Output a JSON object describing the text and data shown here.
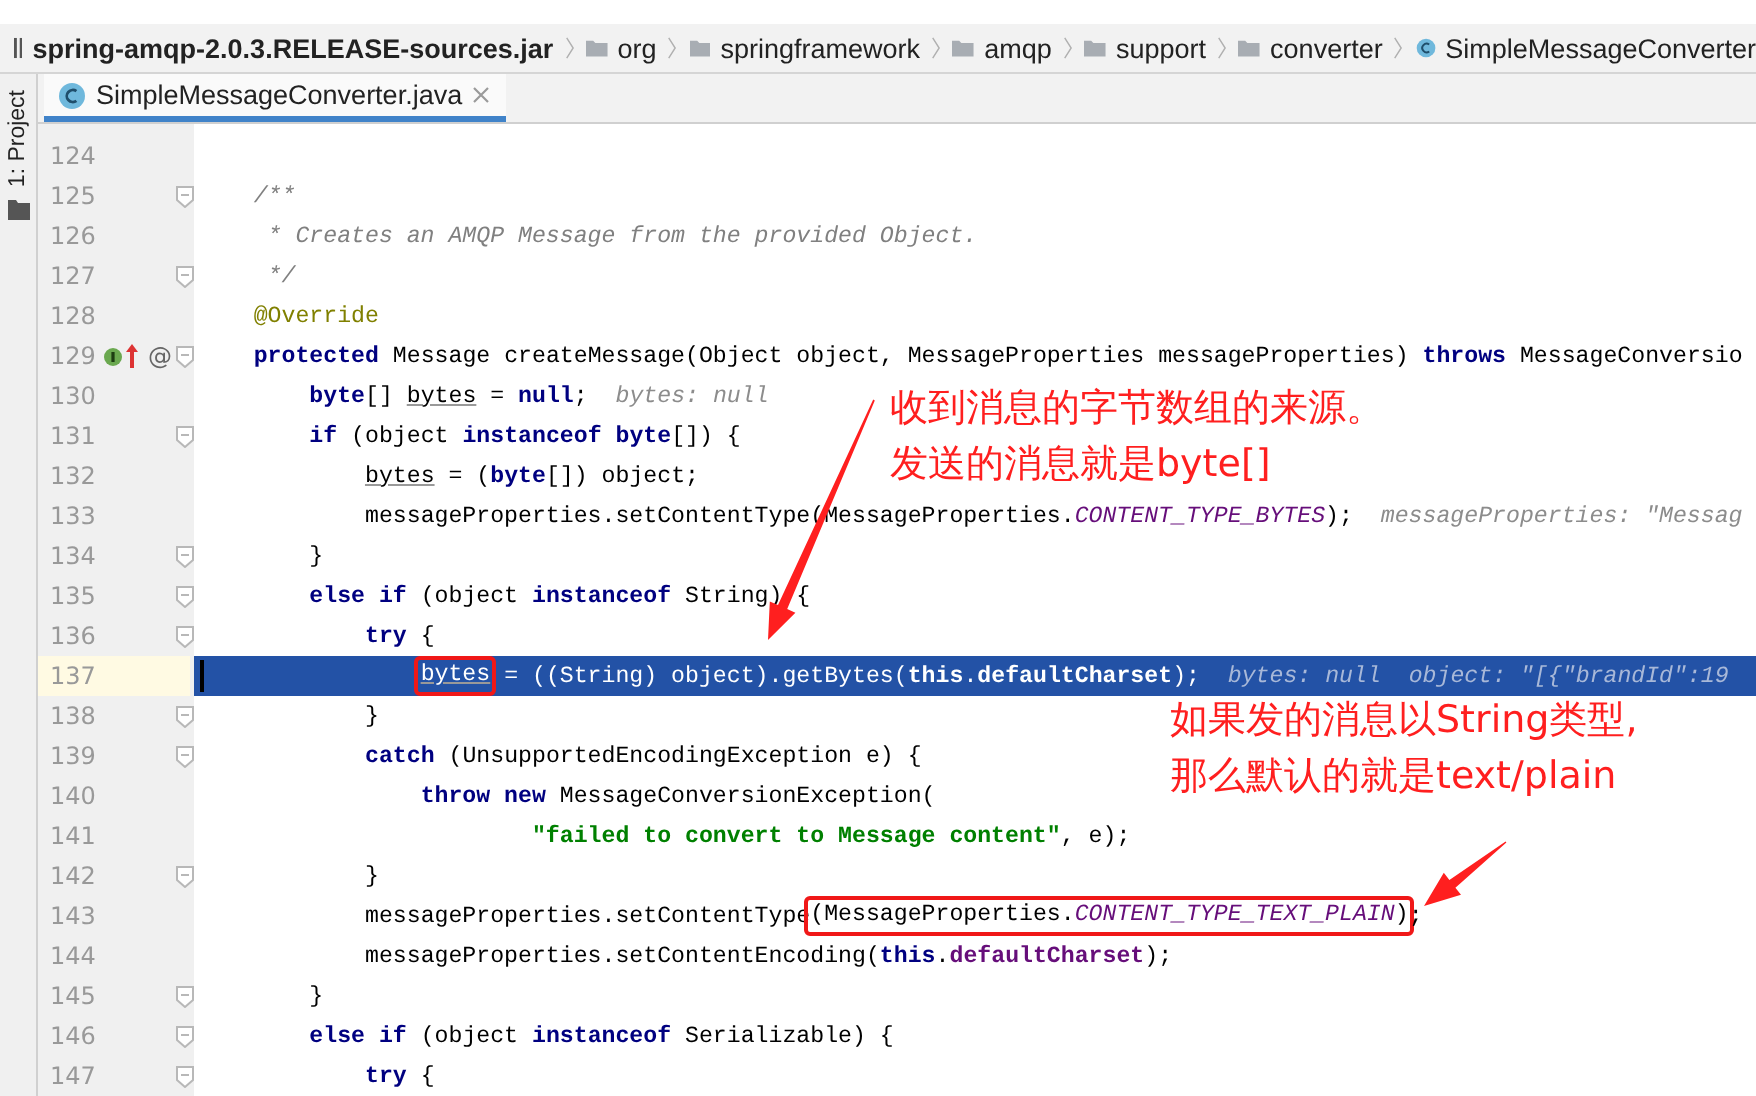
{
  "breadcrumb": {
    "root": "spring-amqp-2.0.3.RELEASE-sources.jar",
    "items": [
      {
        "kind": "folder",
        "label": "org"
      },
      {
        "kind": "folder",
        "label": "springframework"
      },
      {
        "kind": "folder",
        "label": "amqp"
      },
      {
        "kind": "folder",
        "label": "support"
      },
      {
        "kind": "folder",
        "label": "converter"
      },
      {
        "kind": "class",
        "label": "SimpleMessageConverter"
      }
    ]
  },
  "tool_window_tab": "1: Project",
  "tabs": [
    {
      "label": "SimpleMessageConverter.java",
      "selected": true
    }
  ],
  "lines": [
    {
      "number": "124",
      "fold": false,
      "selected": false
    },
    {
      "number": "125",
      "fold": true,
      "selected": false,
      "tokens": [
        {
          "kind": "comment",
          "text": "    /**"
        }
      ]
    },
    {
      "number": "126",
      "fold": false,
      "selected": false,
      "tokens": [
        {
          "kind": "comment",
          "text": "     * Creates an AMQP Message from the provided Object."
        }
      ]
    },
    {
      "number": "127",
      "fold": true,
      "selected": false,
      "tokens": [
        {
          "kind": "comment",
          "text": "     */"
        }
      ]
    },
    {
      "number": "128",
      "fold": false,
      "selected": false,
      "tokens": [
        {
          "kind": "annotation",
          "text": "    @Override"
        }
      ]
    },
    {
      "number": "129",
      "fold": true,
      "selected": false,
      "gutter_mark": "@",
      "tokens": [
        {
          "kind": "keyword",
          "text": "    protected"
        },
        {
          "kind": "plain",
          "text": " Message createMessage(Object object, MessageProperties messageProperties) "
        },
        {
          "kind": "keyword",
          "text": "throws"
        },
        {
          "kind": "plain",
          "text": " MessageConversio"
        }
      ]
    },
    {
      "number": "130",
      "fold": false,
      "selected": false,
      "hints": [
        "bytes: null"
      ],
      "tokens": [
        {
          "kind": "keyword",
          "text": "        byte"
        },
        {
          "kind": "plain",
          "text": "[] "
        },
        {
          "kind": "variable",
          "text": "bytes"
        },
        {
          "kind": "plain",
          "text": " = "
        },
        {
          "kind": "keyword",
          "text": "null"
        },
        {
          "kind": "plain",
          "text": ";"
        }
      ]
    },
    {
      "number": "131",
      "fold": true,
      "selected": false,
      "tokens": [
        {
          "kind": "keyword",
          "text": "        if"
        },
        {
          "kind": "plain",
          "text": " (object "
        },
        {
          "kind": "keyword",
          "text": "instanceof byte"
        },
        {
          "kind": "plain",
          "text": "[]) {"
        }
      ]
    },
    {
      "number": "132",
      "fold": false,
      "selected": false,
      "tokens": [
        {
          "kind": "variable",
          "text": "            bytes"
        },
        {
          "kind": "plain",
          "text": " = ("
        },
        {
          "kind": "keyword",
          "text": "byte"
        },
        {
          "kind": "plain",
          "text": "[]) object;"
        }
      ]
    },
    {
      "number": "133",
      "fold": false,
      "selected": false,
      "hints": [
        "messageProperties: \"Messag"
      ],
      "tokens": [
        {
          "kind": "plain",
          "text": "            messageProperties.setContentType(MessageProperties."
        },
        {
          "kind": "constant",
          "text": "CONTENT_TYPE_BYTES"
        },
        {
          "kind": "plain",
          "text": ");"
        }
      ]
    },
    {
      "number": "134",
      "fold": true,
      "selected": false,
      "tokens": [
        {
          "kind": "plain",
          "text": "        }"
        }
      ]
    },
    {
      "number": "135",
      "fold": true,
      "selected": false,
      "tokens": [
        {
          "kind": "keyword",
          "text": "        else if"
        },
        {
          "kind": "plain",
          "text": " (object "
        },
        {
          "kind": "keyword",
          "text": "instanceof"
        },
        {
          "kind": "plain",
          "text": " String) {"
        }
      ]
    },
    {
      "number": "136",
      "fold": true,
      "selected": false,
      "tokens": [
        {
          "kind": "keyword",
          "text": "            try"
        },
        {
          "kind": "plain",
          "text": " {"
        }
      ]
    },
    {
      "number": "137",
      "fold": false,
      "selected": true,
      "hints": [
        "bytes: null",
        "object: \"[{\"brandId\":19"
      ],
      "tokens": [
        {
          "kind": "boxed",
          "tokens": [
            {
              "kind": "variable",
              "text": "                bytes"
            }
          ]
        },
        {
          "kind": "plain",
          "text": " = ((String) object).getBytes("
        },
        {
          "kind": "keyword",
          "text": "this"
        },
        {
          "kind": "plain",
          "text": "."
        },
        {
          "kind": "field",
          "text": "defaultCharset"
        },
        {
          "kind": "plain",
          "text": ");"
        }
      ]
    },
    {
      "number": "138",
      "fold": true,
      "selected": false,
      "tokens": [
        {
          "kind": "plain",
          "text": "            }"
        }
      ]
    },
    {
      "number": "139",
      "fold": true,
      "selected": false,
      "tokens": [
        {
          "kind": "keyword",
          "text": "            catch"
        },
        {
          "kind": "plain",
          "text": " (UnsupportedEncodingException e) {"
        }
      ]
    },
    {
      "number": "140",
      "fold": false,
      "selected": false,
      "tokens": [
        {
          "kind": "keyword",
          "text": "                throw new"
        },
        {
          "kind": "plain",
          "text": " MessageConversionException("
        }
      ]
    },
    {
      "number": "141",
      "fold": false,
      "selected": false,
      "tokens": [
        {
          "kind": "string",
          "text": "                        \"failed to convert to Message content\""
        },
        {
          "kind": "plain",
          "text": ", e);"
        }
      ]
    },
    {
      "number": "142",
      "fold": true,
      "selected": false,
      "tokens": [
        {
          "kind": "plain",
          "text": "            }"
        }
      ]
    },
    {
      "number": "143",
      "fold": false,
      "selected": false,
      "tokens": [
        {
          "kind": "plain",
          "text": "            messageProperties.setContentType"
        },
        {
          "kind": "boxed",
          "tokens": [
            {
              "kind": "plain",
              "text": "(MessageProperties."
            },
            {
              "kind": "constant",
              "text": "CONTENT_TYPE_TEXT_PLAIN"
            },
            {
              "kind": "plain",
              "text": ")"
            }
          ]
        },
        {
          "kind": "plain",
          "text": ";"
        }
      ]
    },
    {
      "number": "144",
      "fold": false,
      "selected": false,
      "tokens": [
        {
          "kind": "plain",
          "text": "            messageProperties.setContentEncoding("
        },
        {
          "kind": "keyword",
          "text": "this"
        },
        {
          "kind": "plain",
          "text": "."
        },
        {
          "kind": "field",
          "text": "defaultCharset"
        },
        {
          "kind": "plain",
          "text": ");"
        }
      ]
    },
    {
      "number": "145",
      "fold": true,
      "selected": false,
      "tokens": [
        {
          "kind": "plain",
          "text": "        }"
        }
      ]
    },
    {
      "number": "146",
      "fold": true,
      "selected": false,
      "tokens": [
        {
          "kind": "keyword",
          "text": "        else if"
        },
        {
          "kind": "plain",
          "text": " (object "
        },
        {
          "kind": "keyword",
          "text": "instanceof"
        },
        {
          "kind": "plain",
          "text": " Serializable) {"
        }
      ]
    },
    {
      "number": "147",
      "fold": true,
      "selected": false,
      "tokens": [
        {
          "kind": "keyword",
          "text": "            try"
        },
        {
          "kind": "plain",
          "text": " {"
        }
      ]
    }
  ],
  "annotations": [
    {
      "lines": [
        "收到消息的字节数组的来源。",
        "发送的消息就是byte[]"
      ]
    },
    {
      "lines": [
        "如果发的消息以String类型,",
        "那么默认的就是text/plain"
      ]
    }
  ]
}
